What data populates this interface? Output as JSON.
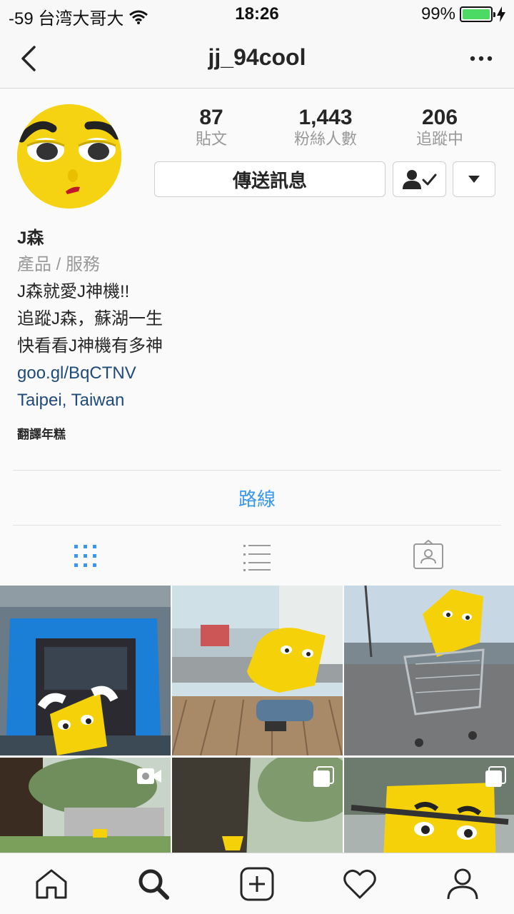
{
  "status_bar": {
    "carrier": "-59 台湾大哥大",
    "time": "18:26",
    "battery_text": "99%",
    "battery_level": 0.99,
    "battery_color": "#4cd964"
  },
  "nav": {
    "title": "jj_94cool",
    "back_icon": "chevron-left-icon",
    "more_icon": "more-horizontal-icon"
  },
  "stats": [
    {
      "value": "87",
      "label": "貼文"
    },
    {
      "value": "1,443",
      "label": "粉絲人數"
    },
    {
      "value": "206",
      "label": "追蹤中"
    }
  ],
  "buttons": {
    "message": "傳送訊息",
    "following_icon": "person-check-icon",
    "dropdown_icon": "caret-down-icon"
  },
  "bio": {
    "name": "J森",
    "category": "產品 / 服務",
    "lines": [
      "J森就愛J神機!!",
      "追蹤J森，蘇湖一生",
      "快看看J神機有多神"
    ],
    "link": "goo.gl/BqCTNV",
    "location": "Taipei, Taiwan",
    "translate": "翻譯年糕"
  },
  "directions": "路線",
  "colors": {
    "accent": "#3897f0",
    "link": "#1f4a7a",
    "mascot_yellow": "#f5d10a"
  },
  "tabs": [
    "grid-icon",
    "list-icon",
    "tagged-icon"
  ],
  "bottom_tabs": [
    "home-icon",
    "search-icon",
    "add-post-icon",
    "heart-icon",
    "profile-icon"
  ]
}
